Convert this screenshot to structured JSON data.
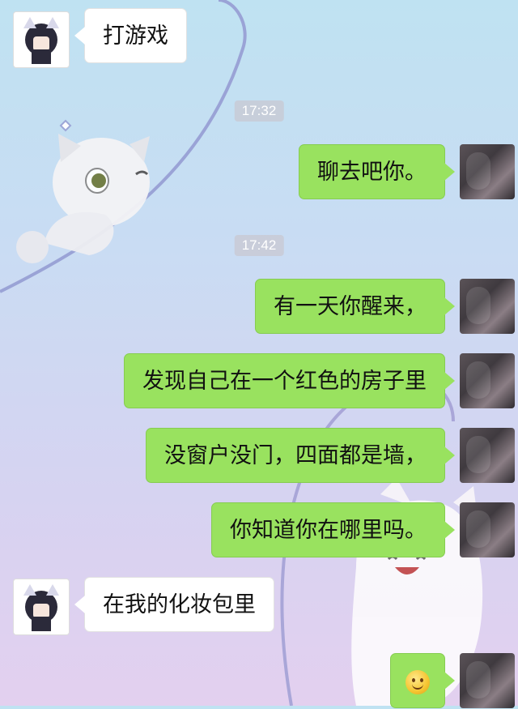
{
  "messages": [
    {
      "side": "other",
      "text": "打游戏"
    },
    {
      "side": "time",
      "text": "17:32"
    },
    {
      "side": "me",
      "text": "聊去吧你。"
    },
    {
      "side": "time",
      "text": "17:42"
    },
    {
      "side": "me",
      "text": "有一天你醒来，"
    },
    {
      "side": "me",
      "text": "发现自己在一个红色的房子里"
    },
    {
      "side": "me",
      "text": "没窗户没门，四面都是墙，"
    },
    {
      "side": "me",
      "text": "你知道你在哪里吗。"
    },
    {
      "side": "other",
      "text": "在我的化妆包里"
    },
    {
      "side": "me",
      "emoji": "smiley-icon"
    }
  ],
  "colors": {
    "my_bubble": "#99e25f",
    "other_bubble": "#ffffff",
    "timestamp_bg": "#c8c8d2"
  }
}
